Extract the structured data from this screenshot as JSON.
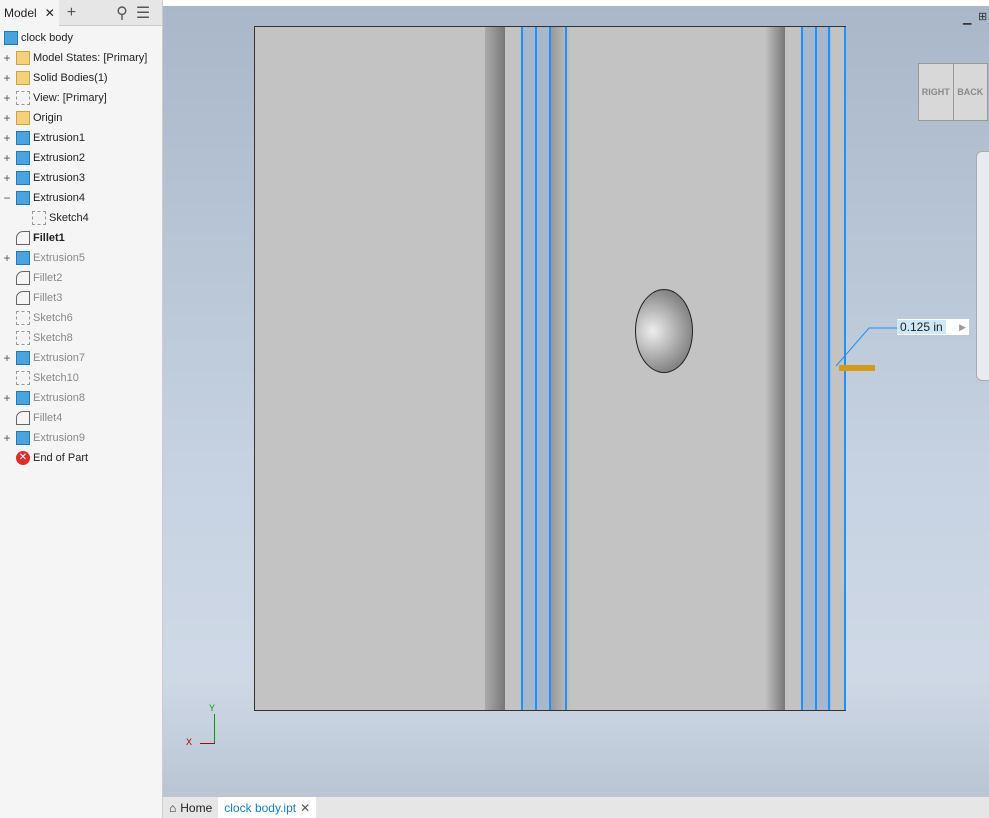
{
  "browser": {
    "tab": "Model",
    "items": [
      {
        "label": "clock body",
        "icon": "part-icon",
        "expander": ""
      },
      {
        "label": "Model States: [Primary]",
        "icon": "folder-icon",
        "expander": "+"
      },
      {
        "label": "Solid Bodies(1)",
        "icon": "folder-icon",
        "expander": "+"
      },
      {
        "label": "View: [Primary]",
        "icon": "view-icon",
        "expander": "+"
      },
      {
        "label": "Origin",
        "icon": "folder-icon",
        "expander": "+"
      },
      {
        "label": "Extrusion1",
        "icon": "extrusion-icon",
        "expander": "+"
      },
      {
        "label": "Extrusion2",
        "icon": "extrusion-icon",
        "expander": "+"
      },
      {
        "label": "Extrusion3",
        "icon": "extrusion-icon",
        "expander": "+"
      },
      {
        "label": "Extrusion4",
        "icon": "extrusion-icon",
        "expander": "−"
      },
      {
        "label": "Sketch4",
        "icon": "sketch-icon",
        "expander": ""
      },
      {
        "label": "Fillet1",
        "icon": "fillet-icon",
        "expander": ""
      },
      {
        "label": "Extrusion5",
        "icon": "extrusion-icon",
        "expander": "+"
      },
      {
        "label": "Fillet2",
        "icon": "fillet-icon",
        "expander": ""
      },
      {
        "label": "Fillet3",
        "icon": "fillet-icon",
        "expander": ""
      },
      {
        "label": "Sketch6",
        "icon": "sketch-icon",
        "expander": ""
      },
      {
        "label": "Sketch8",
        "icon": "sketch-icon",
        "expander": ""
      },
      {
        "label": "Extrusion7",
        "icon": "extrusion-icon",
        "expander": "+"
      },
      {
        "label": "Sketch10",
        "icon": "sketch-icon",
        "expander": ""
      },
      {
        "label": "Extrusion8",
        "icon": "extrusion-icon",
        "expander": "+"
      },
      {
        "label": "Fillet4",
        "icon": "fillet-icon",
        "expander": ""
      },
      {
        "label": "Extrusion9",
        "icon": "extrusion-icon",
        "expander": "+"
      },
      {
        "label": "End of Part",
        "icon": "end-of-part-icon",
        "expander": ""
      }
    ]
  },
  "viewcube": {
    "right": "RIGHT",
    "back": "BACK"
  },
  "dimension": {
    "value": "0.125 in"
  },
  "axes": {
    "y": "Y",
    "x": "X"
  },
  "doctabs": {
    "home": "Home",
    "file": "clock body.ipt"
  }
}
